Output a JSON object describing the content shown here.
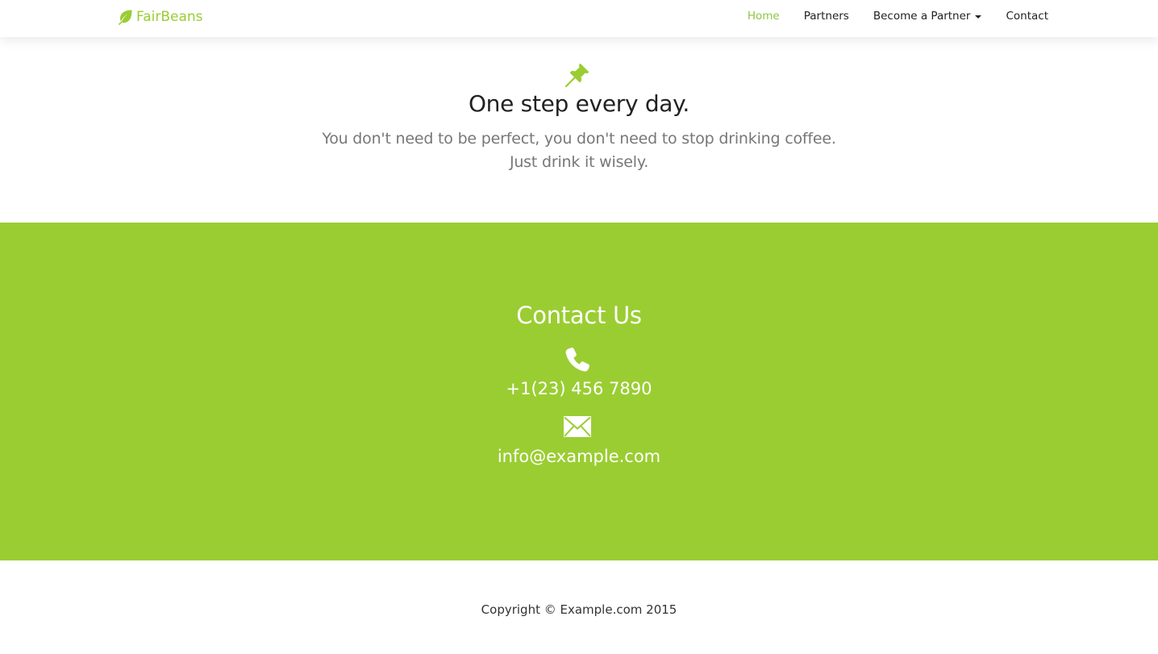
{
  "brand": {
    "name": "FairBeans",
    "icon": "leaf-icon",
    "color": "#9acd32"
  },
  "nav": {
    "items": [
      {
        "label": "Home",
        "active": true
      },
      {
        "label": "Partners",
        "active": false
      },
      {
        "label": "Become a Partner",
        "active": false,
        "dropdown": true
      },
      {
        "label": "Contact",
        "active": false
      }
    ],
    "active_color": "#8cc63f"
  },
  "intro": {
    "icon": "pushpin-icon",
    "title": "One step every day.",
    "subtitle_line1": "You don't need to be perfect, you don't need to stop drinking coffee.",
    "subtitle_line2": "Just drink it wisely."
  },
  "contact": {
    "title": "Contact Us",
    "phone_icon": "phone-icon",
    "phone": "+1(23) 456 7890",
    "email_icon": "envelope-icon",
    "email": "info@example.com",
    "background": "#9acd32"
  },
  "footer": {
    "copyright": "Copyright © Example.com 2015"
  }
}
